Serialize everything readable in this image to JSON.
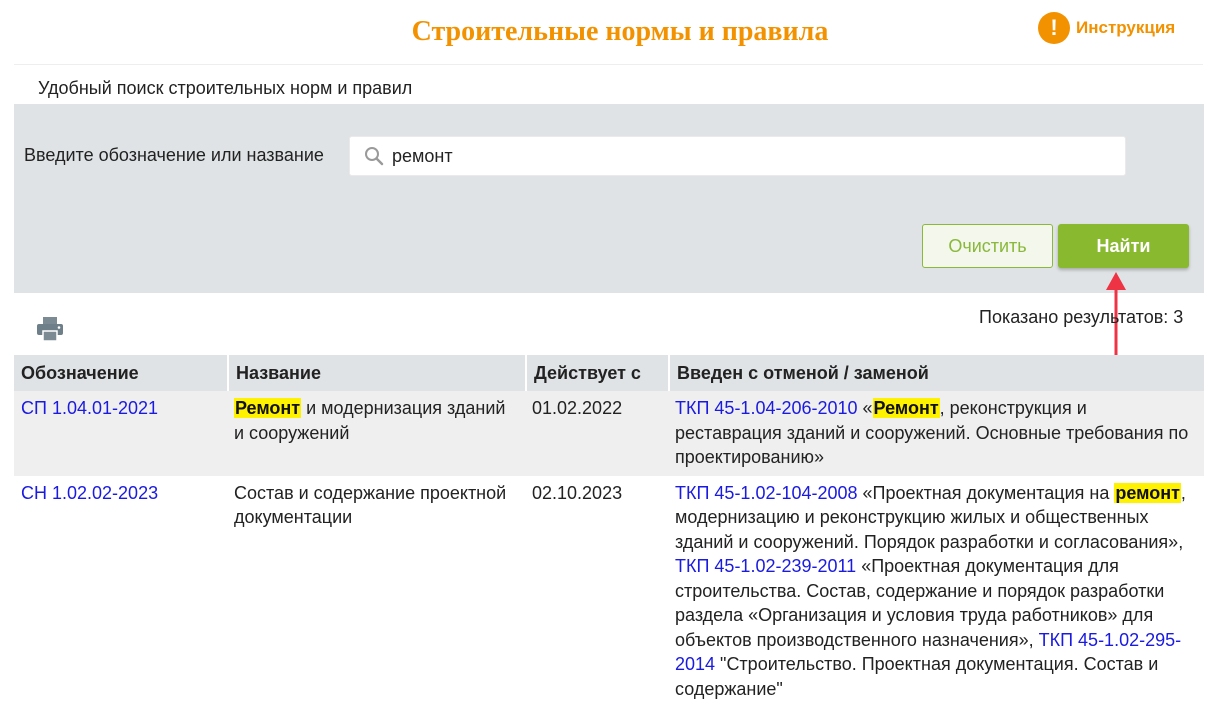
{
  "header": {
    "title": "Строительные нормы и правила",
    "instruction_label": "Инструкция",
    "instruction_icon": "!"
  },
  "subtitle": "Удобный поиск строительных норм и правил",
  "search": {
    "label": "Введите обозначение или название",
    "value": "ремонт",
    "clear_label": "Очистить",
    "find_label": "Найти"
  },
  "results_count": "Показано результатов: 3",
  "table": {
    "columns": [
      "Обозначение",
      "Название",
      "Действует с",
      "Введен с отменой / заменой"
    ],
    "rows": [
      {
        "code": "СП 1.04.01-2021",
        "name": [
          {
            "t": "Ремонт",
            "h": true
          },
          {
            "t": " и модернизация зданий и сооружений"
          }
        ],
        "date": "01.02.2022",
        "replaced": [
          {
            "t": "ТКП 45-1.04-206-2010",
            "link": true
          },
          {
            "t": " «"
          },
          {
            "t": "Ремонт",
            "h": true
          },
          {
            "t": ", реконструкция и реставрация зданий и сооружений. Основные требования по проектированию»"
          }
        ]
      },
      {
        "code": "СН 1.02.02-2023",
        "name": [
          {
            "t": "Состав и содержание проектной документации"
          }
        ],
        "date": "02.10.2023",
        "replaced": [
          {
            "t": "ТКП 45-1.02-104-2008",
            "link": true
          },
          {
            "t": " «Проектная документация на "
          },
          {
            "t": "ремонт",
            "h": true
          },
          {
            "t": ", модернизацию и реконструкцию жилых и общественных зданий и сооружений. Порядок разработки и согласования», "
          },
          {
            "t": "ТКП 45-1.02-239-2011",
            "link": true
          },
          {
            "t": " «Проектная документация для строительства. Состав, содержание и порядок разработки раздела «Организация и условия труда работников» для объектов производственного назначения», "
          },
          {
            "t": "ТКП 45-1.02-295-2014",
            "link": true
          },
          {
            "t": " \"Строительство. Проектная документация. Состав и содержание\""
          }
        ]
      }
    ]
  },
  "colors": {
    "accent_orange": "#f39200",
    "button_green": "#89b92f",
    "panel_gray": "#dfe3e5",
    "link_blue": "#1a1ae0",
    "highlight_yellow": "#fff200",
    "arrow_red": "#ee3344"
  },
  "icons": {
    "instruction": "exclamation-circle-icon",
    "search": "magnifier-icon",
    "print": "printer-icon",
    "annotation": "red-arrow-icon"
  }
}
